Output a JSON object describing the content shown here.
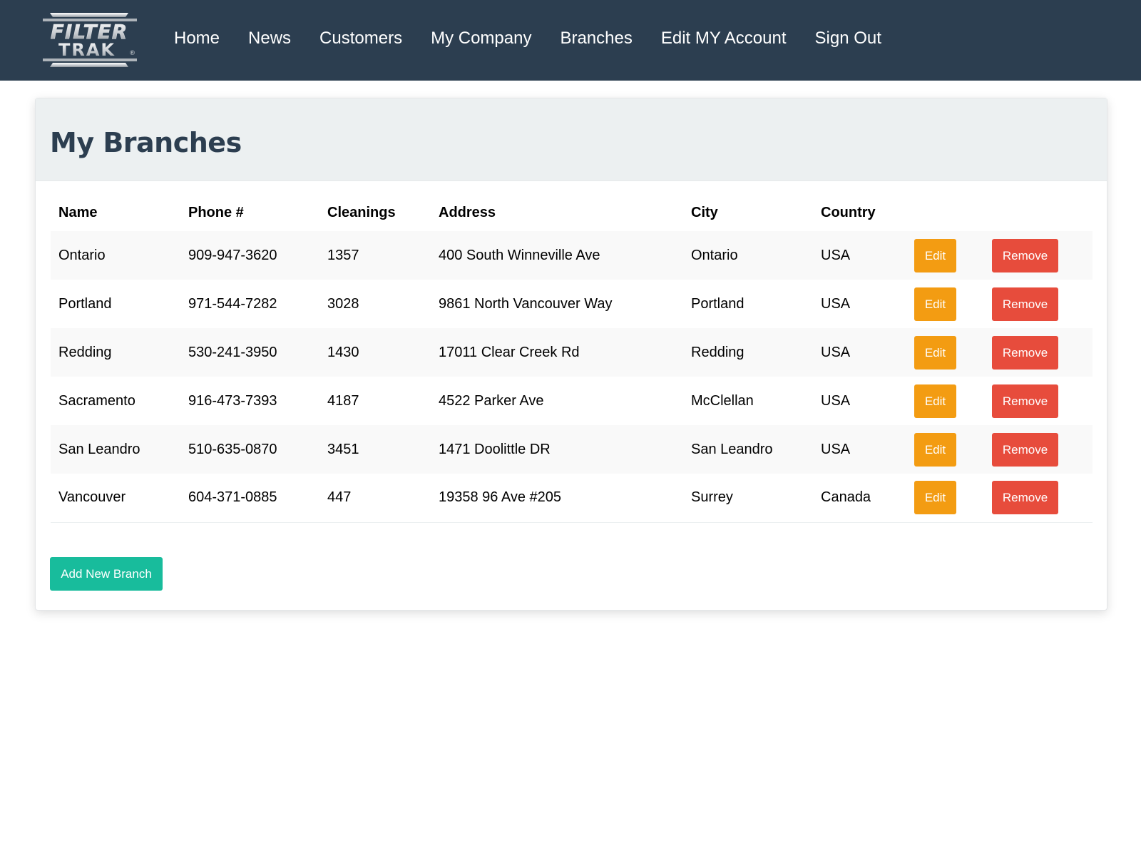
{
  "brand": {
    "logo_line1": "FILTER",
    "logo_line2": "TRAK",
    "logo_mark": "®"
  },
  "nav": {
    "items": [
      {
        "label": "Home"
      },
      {
        "label": "News"
      },
      {
        "label": "Customers"
      },
      {
        "label": "My Company"
      },
      {
        "label": "Branches"
      },
      {
        "label": "Edit MY Account"
      },
      {
        "label": "Sign Out"
      }
    ]
  },
  "page": {
    "title": "My Branches"
  },
  "table": {
    "columns": [
      "Name",
      "Phone #",
      "Cleanings",
      "Address",
      "City",
      "Country"
    ],
    "rows": [
      {
        "name": "Ontario",
        "phone": "909-947-3620",
        "cleanings": "1357",
        "address": "400 South Winneville Ave",
        "city": "Ontario",
        "country": "USA"
      },
      {
        "name": "Portland",
        "phone": "971-544-7282",
        "cleanings": "3028",
        "address": "9861 North Vancouver Way",
        "city": "Portland",
        "country": "USA"
      },
      {
        "name": "Redding",
        "phone": "530-241-3950",
        "cleanings": "1430",
        "address": "17011 Clear Creek Rd",
        "city": "Redding",
        "country": "USA"
      },
      {
        "name": "Sacramento",
        "phone": "916-473-7393",
        "cleanings": "4187",
        "address": "4522 Parker Ave",
        "city": "McClellan",
        "country": "USA"
      },
      {
        "name": "San Leandro",
        "phone": "510-635-0870",
        "cleanings": "3451",
        "address": "1471 Doolittle DR",
        "city": "San Leandro",
        "country": "USA"
      },
      {
        "name": "Vancouver",
        "phone": "604-371-0885",
        "cleanings": "447",
        "address": "19358 96 Ave #205",
        "city": "Surrey",
        "country": "Canada"
      }
    ],
    "edit_label": "Edit",
    "remove_label": "Remove"
  },
  "actions": {
    "add_label": "Add New Branch"
  },
  "colors": {
    "navbar": "#2c3e50",
    "edit": "#f39c12",
    "remove": "#e74c3c",
    "add": "#18bc9c",
    "heading_bg": "#ecf0f1"
  }
}
